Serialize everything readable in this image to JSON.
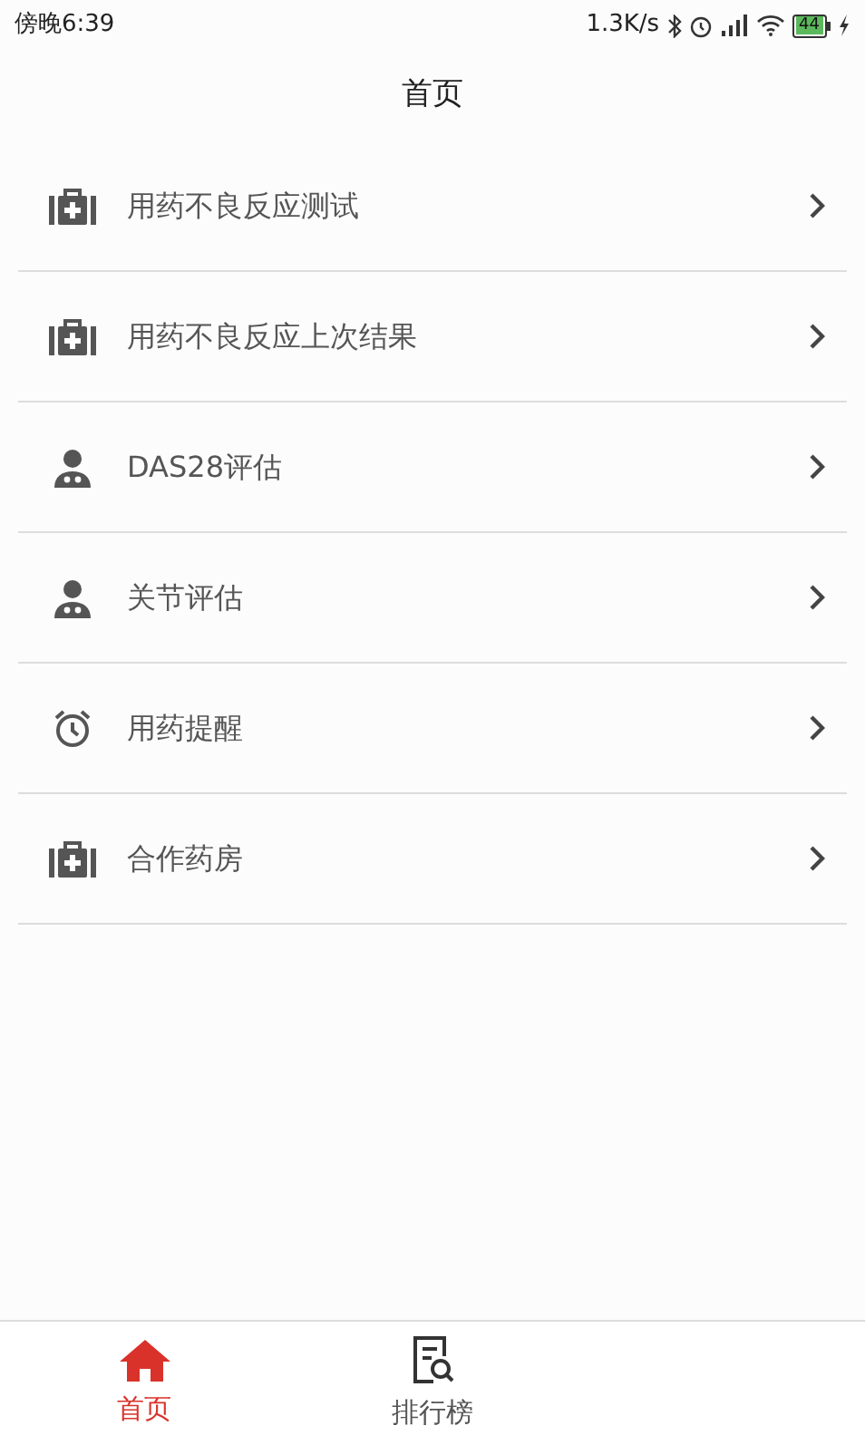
{
  "status_bar": {
    "time": "傍晚6:39",
    "net_speed": "1.3K/s",
    "battery": "44"
  },
  "header": {
    "title": "首页"
  },
  "menu": [
    {
      "label": "用药不良反应测试",
      "kind": "medkit"
    },
    {
      "label": "用药不良反应上次结果",
      "kind": "medkit"
    },
    {
      "label": "DAS28评估",
      "kind": "doctor"
    },
    {
      "label": "关节评估",
      "kind": "doctor"
    },
    {
      "label": "用药提醒",
      "kind": "alarm"
    },
    {
      "label": "合作药房",
      "kind": "medkit"
    }
  ],
  "tab_bar": [
    {
      "label": "首页",
      "selected": true
    },
    {
      "label": "排行榜",
      "selected": false
    }
  ]
}
